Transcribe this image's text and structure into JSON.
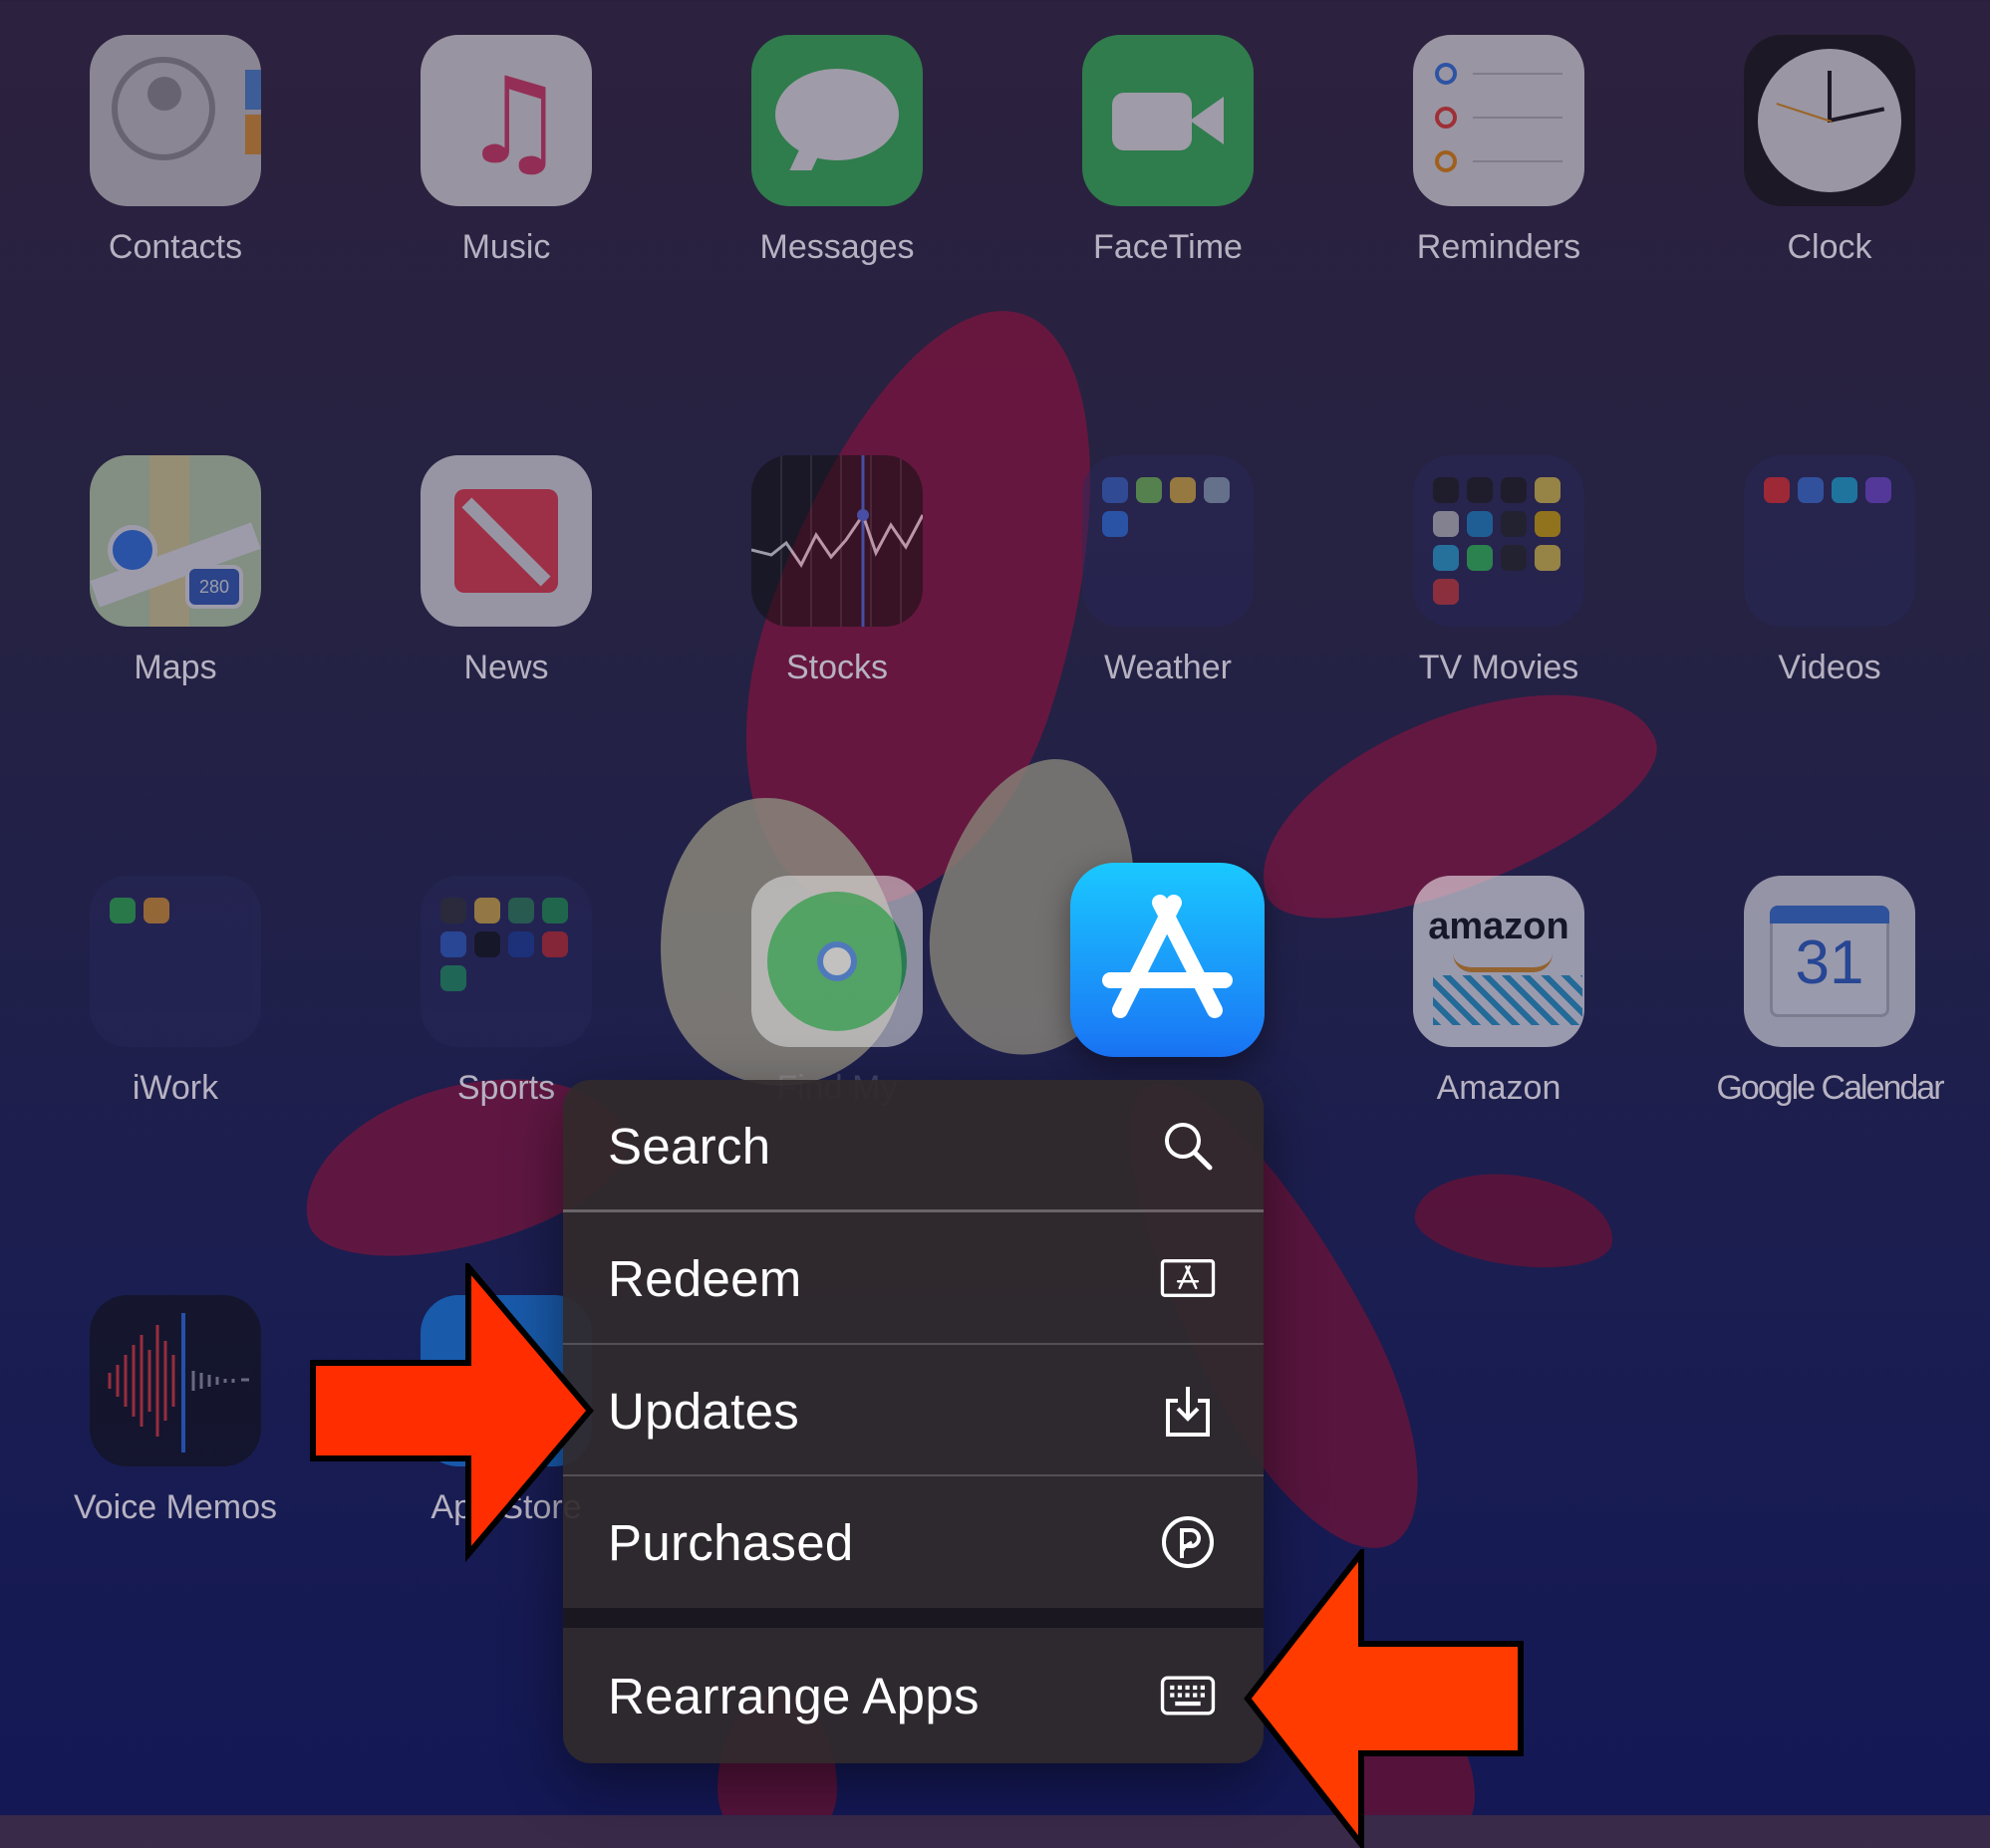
{
  "home_screen": {
    "apps": [
      {
        "label": "Contacts",
        "icon": "contacts-icon"
      },
      {
        "label": "Music",
        "icon": "music-icon"
      },
      {
        "label": "Messages",
        "icon": "messages-icon"
      },
      {
        "label": "FaceTime",
        "icon": "facetime-icon"
      },
      {
        "label": "Reminders",
        "icon": "reminders-icon"
      },
      {
        "label": "Clock",
        "icon": "clock-icon"
      },
      {
        "label": "Maps",
        "icon": "maps-icon",
        "badge": "280"
      },
      {
        "label": "News",
        "icon": "news-icon"
      },
      {
        "label": "Stocks",
        "icon": "stocks-icon"
      },
      {
        "label": "Weather",
        "icon": "weather-folder-icon"
      },
      {
        "label": "TV Movies",
        "icon": "tv-movies-folder-icon"
      },
      {
        "label": "Videos",
        "icon": "videos-folder-icon"
      },
      {
        "label": "iWork",
        "icon": "iwork-folder-icon"
      },
      {
        "label": "Sports",
        "icon": "sports-folder-icon"
      },
      {
        "label": "Find My",
        "icon": "find-my-icon"
      },
      {
        "label": "Amazon",
        "icon": "amazon-icon",
        "brand": "amazon"
      },
      {
        "label": "Google Calendar",
        "icon": "google-calendar-icon",
        "day": "31"
      },
      {
        "label": "Voice Memos",
        "icon": "voice-memos-icon"
      },
      {
        "label": "App Store",
        "icon": "app-store-icon"
      }
    ]
  },
  "focused_app": {
    "name": "App Store",
    "icon": "app-store-icon"
  },
  "context_menu": {
    "items": [
      {
        "label": "Search",
        "icon": "magnifier-icon"
      },
      {
        "label": "Redeem",
        "icon": "redeem-card-icon"
      },
      {
        "label": "Updates",
        "icon": "download-tray-icon"
      },
      {
        "label": "Purchased",
        "icon": "purchased-p-icon"
      },
      {
        "label": "Rearrange Apps",
        "icon": "keyboard-icon"
      }
    ]
  },
  "annotations": {
    "arrow_color": "#ff2d00",
    "arrows": [
      {
        "points_to": "Updates",
        "direction": "right"
      },
      {
        "points_to": "Rearrange Apps",
        "direction": "left"
      }
    ]
  },
  "colors": {
    "menu_background": "#302a2c",
    "app_store_gradient_top": "#1ac8ff",
    "app_store_gradient_bottom": "#1a74f5"
  }
}
